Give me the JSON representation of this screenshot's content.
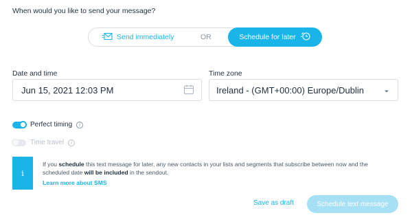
{
  "question": "When would you like to send your message?",
  "send_options": {
    "immediate_label": "Send immediately",
    "or_label": "OR",
    "later_label": "Schedule for later"
  },
  "date_time": {
    "label": "Date and time",
    "value": "Jun 15, 2021 12:03 PM"
  },
  "time_zone": {
    "label": "Time zone",
    "value": "Ireland - (GMT+00:00) Europe/Dublin"
  },
  "perfect_timing": {
    "label": "Perfect timing",
    "enabled": true
  },
  "time_travel": {
    "label": "Time travel",
    "enabled": false
  },
  "info": {
    "icon": "i",
    "text_part1": "If you ",
    "text_bold1": "schedule",
    "text_part2": " this text message for later, any new contacts in your lists and segments that subscribe between now and the scheduled date ",
    "text_bold2": "will be included",
    "text_part3": " in the sendout.",
    "link": "Learn more about SMS"
  },
  "actions": {
    "save_draft": "Save as draft",
    "schedule": "Schedule text message"
  },
  "colors": {
    "accent": "#19b4e8",
    "accent_disabled": "#a6e0f5"
  }
}
